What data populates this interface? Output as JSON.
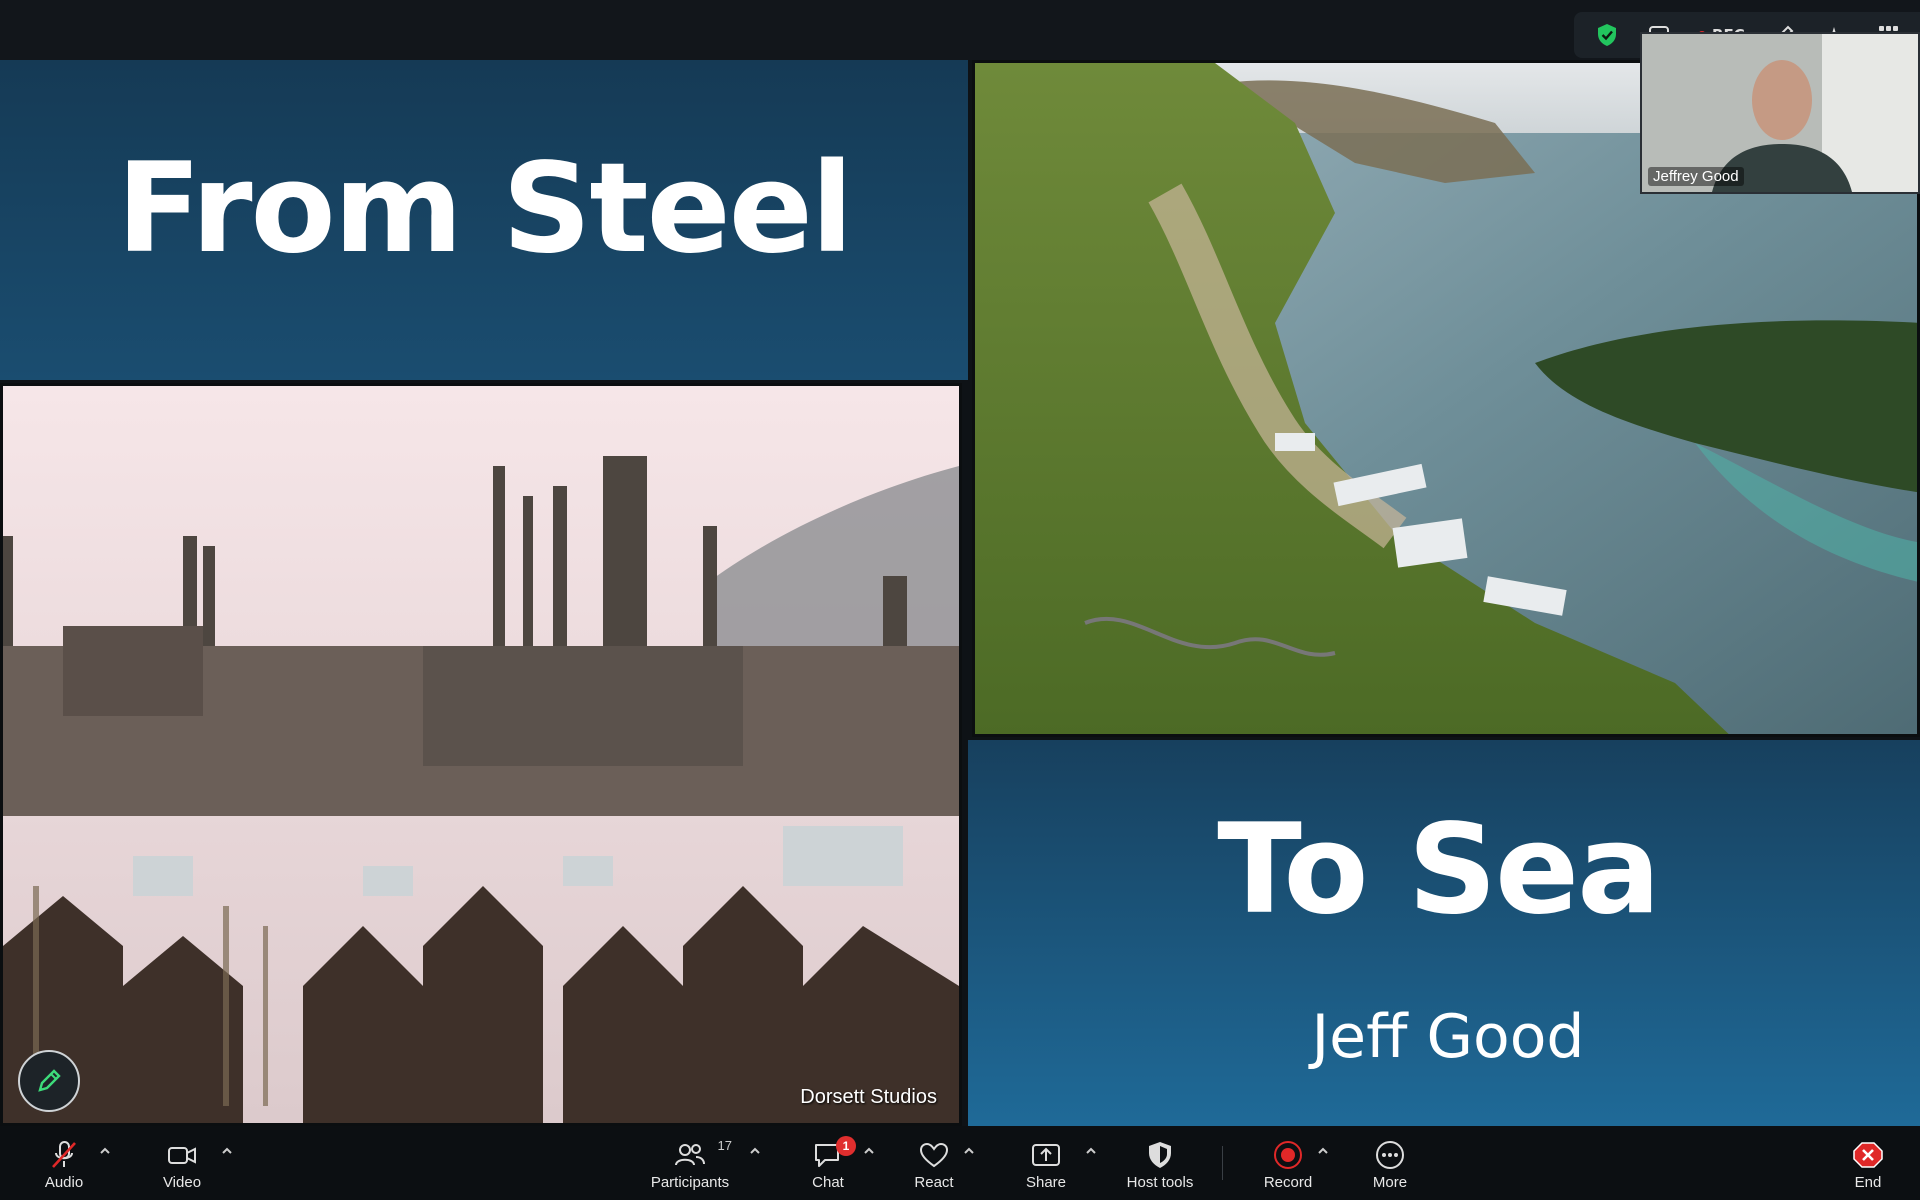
{
  "slide": {
    "title_top": "From Steel",
    "title_bottom": "To Sea",
    "author": "Jeff Good",
    "watermark": "Dorsett Studios"
  },
  "self_video": {
    "name": "Jeffrey Good"
  },
  "top_controls": {
    "rec_label": "REC"
  },
  "toolbar": {
    "audio": "Audio",
    "video": "Video",
    "participants": "Participants",
    "participants_count": "17",
    "chat": "Chat",
    "chat_badge": "1",
    "react": "React",
    "share": "Share",
    "host_tools": "Host tools",
    "record": "Record",
    "more": "More",
    "end": "End"
  },
  "colors": {
    "accent_red": "#e02828",
    "shield_green": "#22c55e"
  }
}
